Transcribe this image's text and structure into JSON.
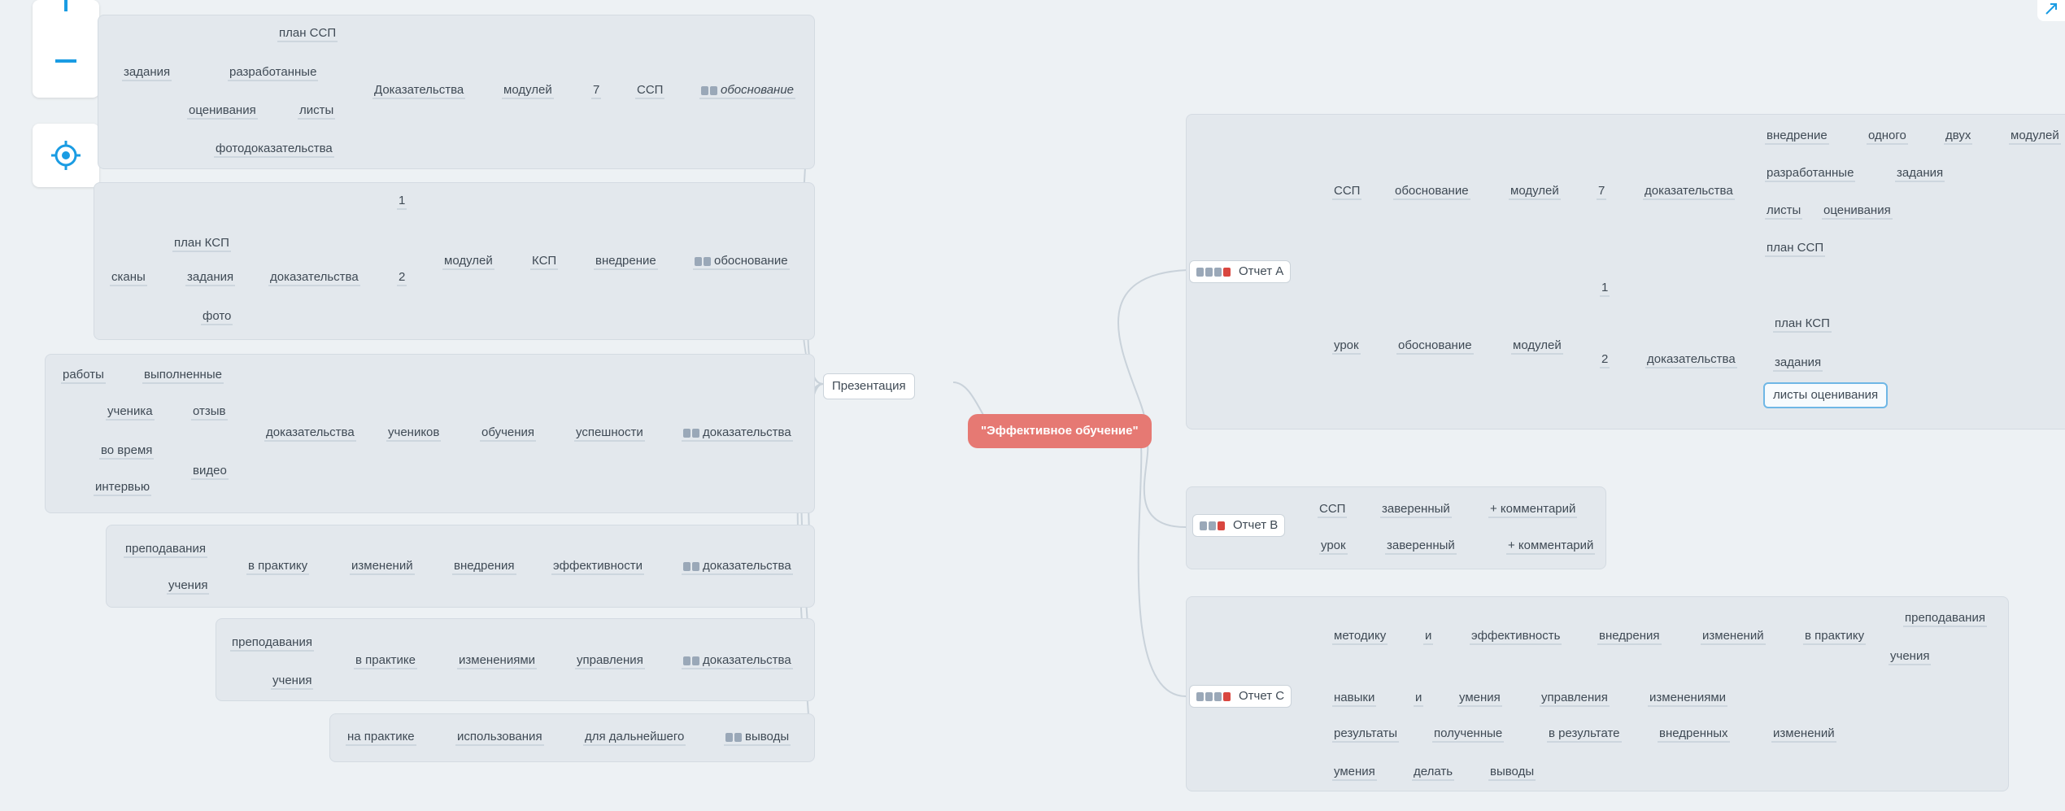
{
  "controls": {
    "zoom_in": "zoom-in",
    "zoom_out": "zoom-out",
    "locate": "locate",
    "colors": {
      "accent": "#1a9ce3"
    }
  },
  "map": {
    "root": "\"Эффективное обучение\"",
    "presentation": "Презентация",
    "left_groups": [
      {
        "head": "обоснование",
        "chain": [
          "ССП",
          "7",
          "модулей",
          "Доказательства"
        ],
        "sub": [
          "план ССП",
          "разработанные",
          "задания",
          "листы",
          "оценивания",
          "фотодоказательства"
        ]
      },
      {
        "head": "обоснование",
        "chain": [
          "внедрение",
          "КСП",
          "модулей"
        ],
        "sub": [
          "1",
          "2",
          "доказательства",
          "план КСП",
          "задания",
          "сканы",
          "фото"
        ]
      },
      {
        "head": "доказательства",
        "chain": [
          "успешности",
          "обучения",
          "учеников",
          "доказательства"
        ],
        "sub": [
          "выполненные",
          "работы",
          "отзыв",
          "ученика",
          "видео",
          "во время",
          "интервью"
        ]
      },
      {
        "head": "доказательства",
        "chain": [
          "эффективности",
          "внедрения",
          "изменений",
          "в практику"
        ],
        "sub": [
          "преподавания",
          "учения"
        ]
      },
      {
        "head": "доказательства",
        "chain": [
          "управления",
          "изменениями",
          "в практике"
        ],
        "sub": [
          "преподавания",
          "учения"
        ]
      },
      {
        "head": "выводы",
        "chain": [
          "для дальнейшего",
          "использования",
          "на практике"
        ],
        "sub": []
      }
    ],
    "report_a": {
      "label": "Отчет A",
      "branch1": [
        "ССП",
        "обоснование",
        "модулей",
        "7",
        "доказательства"
      ],
      "branch1_sub": [
        [
          "внедрение",
          "одного",
          "двух",
          "модулей"
        ],
        [
          "разработанные",
          "задания"
        ],
        [
          "листы",
          "оценивания"
        ],
        [
          "план ССП"
        ]
      ],
      "branch2": [
        "урок",
        "обоснование",
        "модулей"
      ],
      "branch2_nums": [
        "1",
        "2"
      ],
      "branch2_ev": "доказательства",
      "branch2_sub": [
        "план КСП",
        "задания",
        "листы оценивания"
      ]
    },
    "report_b": {
      "label": "Отчет B",
      "rows": [
        [
          "ССП",
          "заверенный",
          "+ комментарий"
        ],
        [
          "урок",
          "заверенный",
          "+ комментарий"
        ]
      ]
    },
    "report_c": {
      "label": "Отчет C",
      "row1": [
        "методику",
        "и",
        "эффективность",
        "внедрения",
        "изменений",
        "в практику"
      ],
      "row1_tail": [
        "преподавания",
        "учения"
      ],
      "row2": [
        "навыки",
        "и",
        "умения",
        "управления",
        "изменениями"
      ],
      "row3": [
        "результаты",
        "полученные",
        "в результате",
        "внедренных",
        "изменений"
      ],
      "row4": [
        "умения",
        "делать",
        "выводы"
      ]
    }
  }
}
